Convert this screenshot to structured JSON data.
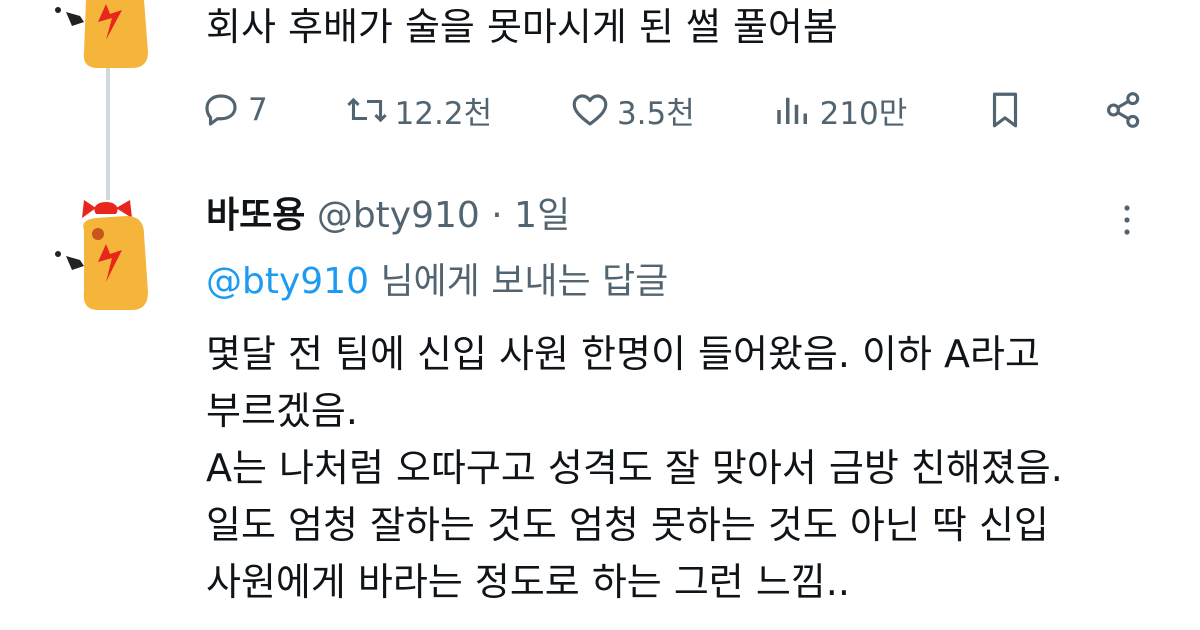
{
  "tweet1": {
    "text": "회사 후배가 술을 못마시게 된 썰 풀어봄",
    "stats": {
      "replies": "7",
      "retweets": "12.2천",
      "likes": "3.5천",
      "views": "210만"
    }
  },
  "reply": {
    "name": "바또용",
    "handle": "@bty910",
    "separator": "·",
    "time": "1일",
    "replying_mention": "@bty910",
    "replying_suffix": "님에게 보내는 답글",
    "lines": [
      "몇달 전 팀에 신입 사원 한명이 들어왔음. 이하 A라고",
      "부르겠음.",
      "A는 나처럼 오따구고 성격도 잘 맞아서 금방 친해졌음.",
      "일도 엄청 잘하는 것도 엄청 못하는 것도 아닌 딱 신입",
      "사원에게 바라는 정도로 하는 그런 느낌.."
    ]
  },
  "colors": {
    "text": "#0f1419",
    "secondary": "#536471",
    "mention": "#1d9bf0",
    "thread_line": "#cfd9de",
    "avatar_body": "#f5b53a",
    "avatar_bow": "#e8261c"
  },
  "icons": {
    "reply": "speech-bubble-icon",
    "retweet": "retweet-icon",
    "like": "heart-icon",
    "views": "bar-chart-icon",
    "bookmark": "bookmark-icon",
    "share": "share-icon",
    "more": "more-options-icon"
  }
}
